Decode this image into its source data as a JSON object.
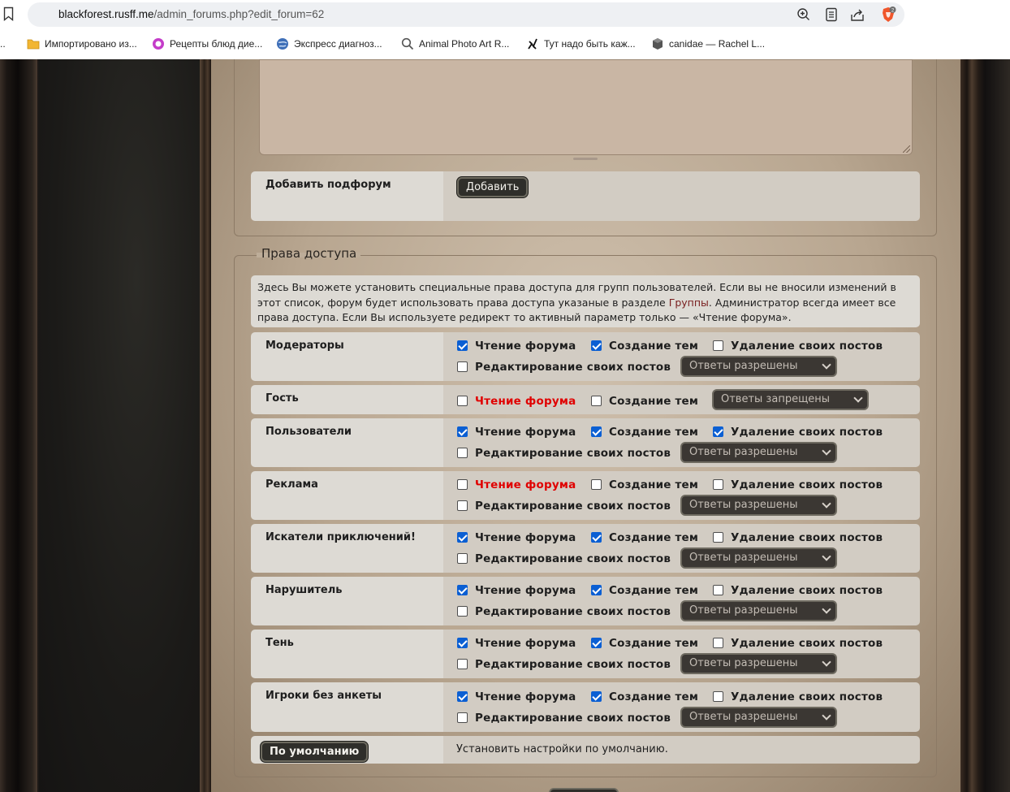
{
  "browser": {
    "url_host": "blackforest.rusff.me",
    "url_path": "/admin_forums.php?edit_forum=62",
    "shield_badge": "2",
    "bookmarks": [
      {
        "label": "Импортировано из...",
        "icon": "folder-icon"
      },
      {
        "label": "Рецепты блюд дие...",
        "icon": "recipe-icon"
      },
      {
        "label": "Экспресс диагноз...",
        "icon": "globe-icon"
      },
      {
        "label": "Animal Photo Art R...",
        "icon": "magnifier-icon"
      },
      {
        "label": "Тут надо быть каж...",
        "icon": "figure-icon"
      },
      {
        "label": "canidae — Rachel L...",
        "icon": "cube-icon"
      }
    ]
  },
  "subforum": {
    "label": "Добавить подфорум",
    "button": "Добавить"
  },
  "access": {
    "legend": "Права доступа",
    "info_before": "Здесь Вы можете установить специальные права доступа для групп пользователей. Если вы не вносили изменений в этот список, форум будет использовать права доступа указаные в разделе ",
    "info_link": "Группы",
    "info_after": ". Администратор всегда имеет все права доступа. Если Вы используете редирект то активный параметр только — «Чтение форума».",
    "perm_labels": {
      "read": "Чтение форума",
      "create": "Создание тем",
      "delete": "Удаление своих постов",
      "edit": "Редактирование своих постов"
    },
    "groups": [
      {
        "name": "Модераторы",
        "read": true,
        "create": true,
        "delete": false,
        "edit": false,
        "replies": "Ответы разрешены"
      },
      {
        "name": "Гость",
        "read": false,
        "create": false,
        "replies": "Ответы запрещены"
      },
      {
        "name": "Пользователи",
        "read": true,
        "create": true,
        "delete": true,
        "edit": false,
        "replies": "Ответы разрешены"
      },
      {
        "name": "Реклама",
        "read": false,
        "create": false,
        "delete": false,
        "edit": false,
        "replies": "Ответы разрешены"
      },
      {
        "name": "Искатели приключений!",
        "read": true,
        "create": true,
        "delete": false,
        "edit": false,
        "replies": "Ответы разрешены"
      },
      {
        "name": "Нарушитель",
        "read": true,
        "create": true,
        "delete": false,
        "edit": false,
        "replies": "Ответы разрешены"
      },
      {
        "name": "Тень",
        "read": true,
        "create": true,
        "delete": false,
        "edit": false,
        "replies": "Ответы разрешены"
      },
      {
        "name": "Игроки без анкеты",
        "read": true,
        "create": true,
        "delete": false,
        "edit": false,
        "replies": "Ответы разрешены"
      }
    ],
    "default_button": "По умолчанию",
    "default_text": "Установить настройки по умолчанию."
  }
}
